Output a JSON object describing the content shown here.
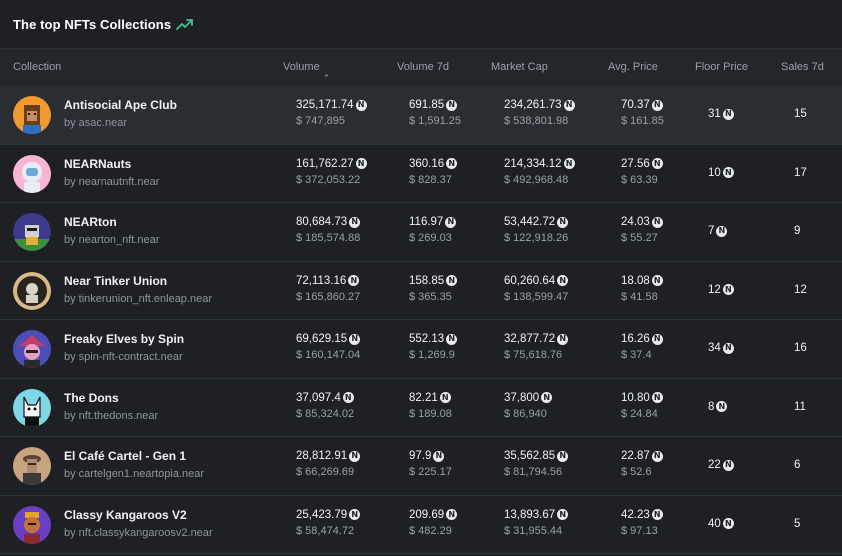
{
  "header": {
    "title": "The top NFTs Collections",
    "icon": "trend-up-icon",
    "accent": "#3ec28f"
  },
  "columns": {
    "collection": "Collection",
    "volume": "Volume",
    "volume7d": "Volume 7d",
    "market_cap": "Market Cap",
    "avg_price": "Avg. Price",
    "floor_price": "Floor Price",
    "sales7d": "Sales 7d"
  },
  "currency_icon": "near-token-icon",
  "rows": [
    {
      "name": "Antisocial Ape Club",
      "owner": "by asac.near",
      "volume": "325,171.74",
      "volume_usd": "$ 747,895",
      "volume7d": "691.85",
      "volume7d_usd": "$ 1,591.25",
      "market_cap": "234,261.73",
      "market_cap_usd": "$ 538,801.98",
      "avg_price": "70.37",
      "avg_price_usd": "$ 161.85",
      "floor": "31",
      "sales7d": "15",
      "avatar_color": "#f29a2e"
    },
    {
      "name": "NEARNauts",
      "owner": "by nearnautnft.near",
      "volume": "161,762.27",
      "volume_usd": "$ 372,053.22",
      "volume7d": "360.16",
      "volume7d_usd": "$ 828.37",
      "market_cap": "214,334.12",
      "market_cap_usd": "$ 492,968.48",
      "avg_price": "27.56",
      "avg_price_usd": "$ 63.39",
      "floor": "10",
      "sales7d": "17",
      "avatar_color": "#f6b7d4"
    },
    {
      "name": "NEARton",
      "owner": "by nearton_nft.near",
      "volume": "80,684.73",
      "volume_usd": "$ 185,574.88",
      "volume7d": "116.97",
      "volume7d_usd": "$ 269.03",
      "market_cap": "53,442.72",
      "market_cap_usd": "$ 122,918.26",
      "avg_price": "24.03",
      "avg_price_usd": "$ 55.27",
      "floor": "7",
      "sales7d": "9",
      "avatar_color": "#3b3a8c"
    },
    {
      "name": "Near Tinker Union",
      "owner": "by tinkerunion_nft.enleap.near",
      "volume": "72,113.16",
      "volume_usd": "$ 165,860.27",
      "volume7d": "158.85",
      "volume7d_usd": "$ 365.35",
      "market_cap": "60,260.64",
      "market_cap_usd": "$ 138,599.47",
      "avg_price": "18.08",
      "avg_price_usd": "$ 41.58",
      "floor": "12",
      "sales7d": "12",
      "avatar_color": "#d9b98a"
    },
    {
      "name": "Freaky Elves by Spin",
      "owner": "by spin-nft-contract.near",
      "volume": "69,629.15",
      "volume_usd": "$ 160,147.04",
      "volume7d": "552.13",
      "volume7d_usd": "$ 1,269.9",
      "market_cap": "32,877.72",
      "market_cap_usd": "$ 75,618.76",
      "avg_price": "16.26",
      "avg_price_usd": "$ 37.4",
      "floor": "34",
      "sales7d": "16",
      "avatar_color": "#c43c6a"
    },
    {
      "name": "The Dons",
      "owner": "by nft.thedons.near",
      "volume": "37,097.4",
      "volume_usd": "$ 85,324.02",
      "volume7d": "82.21",
      "volume7d_usd": "$ 189.08",
      "market_cap": "37,800",
      "market_cap_usd": "$ 86,940",
      "avg_price": "10.80",
      "avg_price_usd": "$ 24.84",
      "floor": "8",
      "sales7d": "11",
      "avatar_color": "#7fd6e6"
    },
    {
      "name": "El Café Cartel - Gen 1",
      "owner": "by cartelgen1.neartopia.near",
      "volume": "28,812.91",
      "volume_usd": "$ 66,269.69",
      "volume7d": "97.9",
      "volume7d_usd": "$ 225.17",
      "market_cap": "35,562.85",
      "market_cap_usd": "$ 81,794.56",
      "avg_price": "22.87",
      "avg_price_usd": "$ 52.6",
      "floor": "22",
      "sales7d": "6",
      "avatar_color": "#b08a6a"
    },
    {
      "name": "Classy Kangaroos V2",
      "owner": "by nft.classykangaroosv2.near",
      "volume": "25,423.79",
      "volume_usd": "$ 58,474.72",
      "volume7d": "209.69",
      "volume7d_usd": "$ 482.29",
      "market_cap": "13,893.67",
      "market_cap_usd": "$ 31,955.44",
      "avg_price": "42.23",
      "avg_price_usd": "$ 97.13",
      "floor": "40",
      "sales7d": "5",
      "avatar_color": "#6a3fc4"
    }
  ]
}
